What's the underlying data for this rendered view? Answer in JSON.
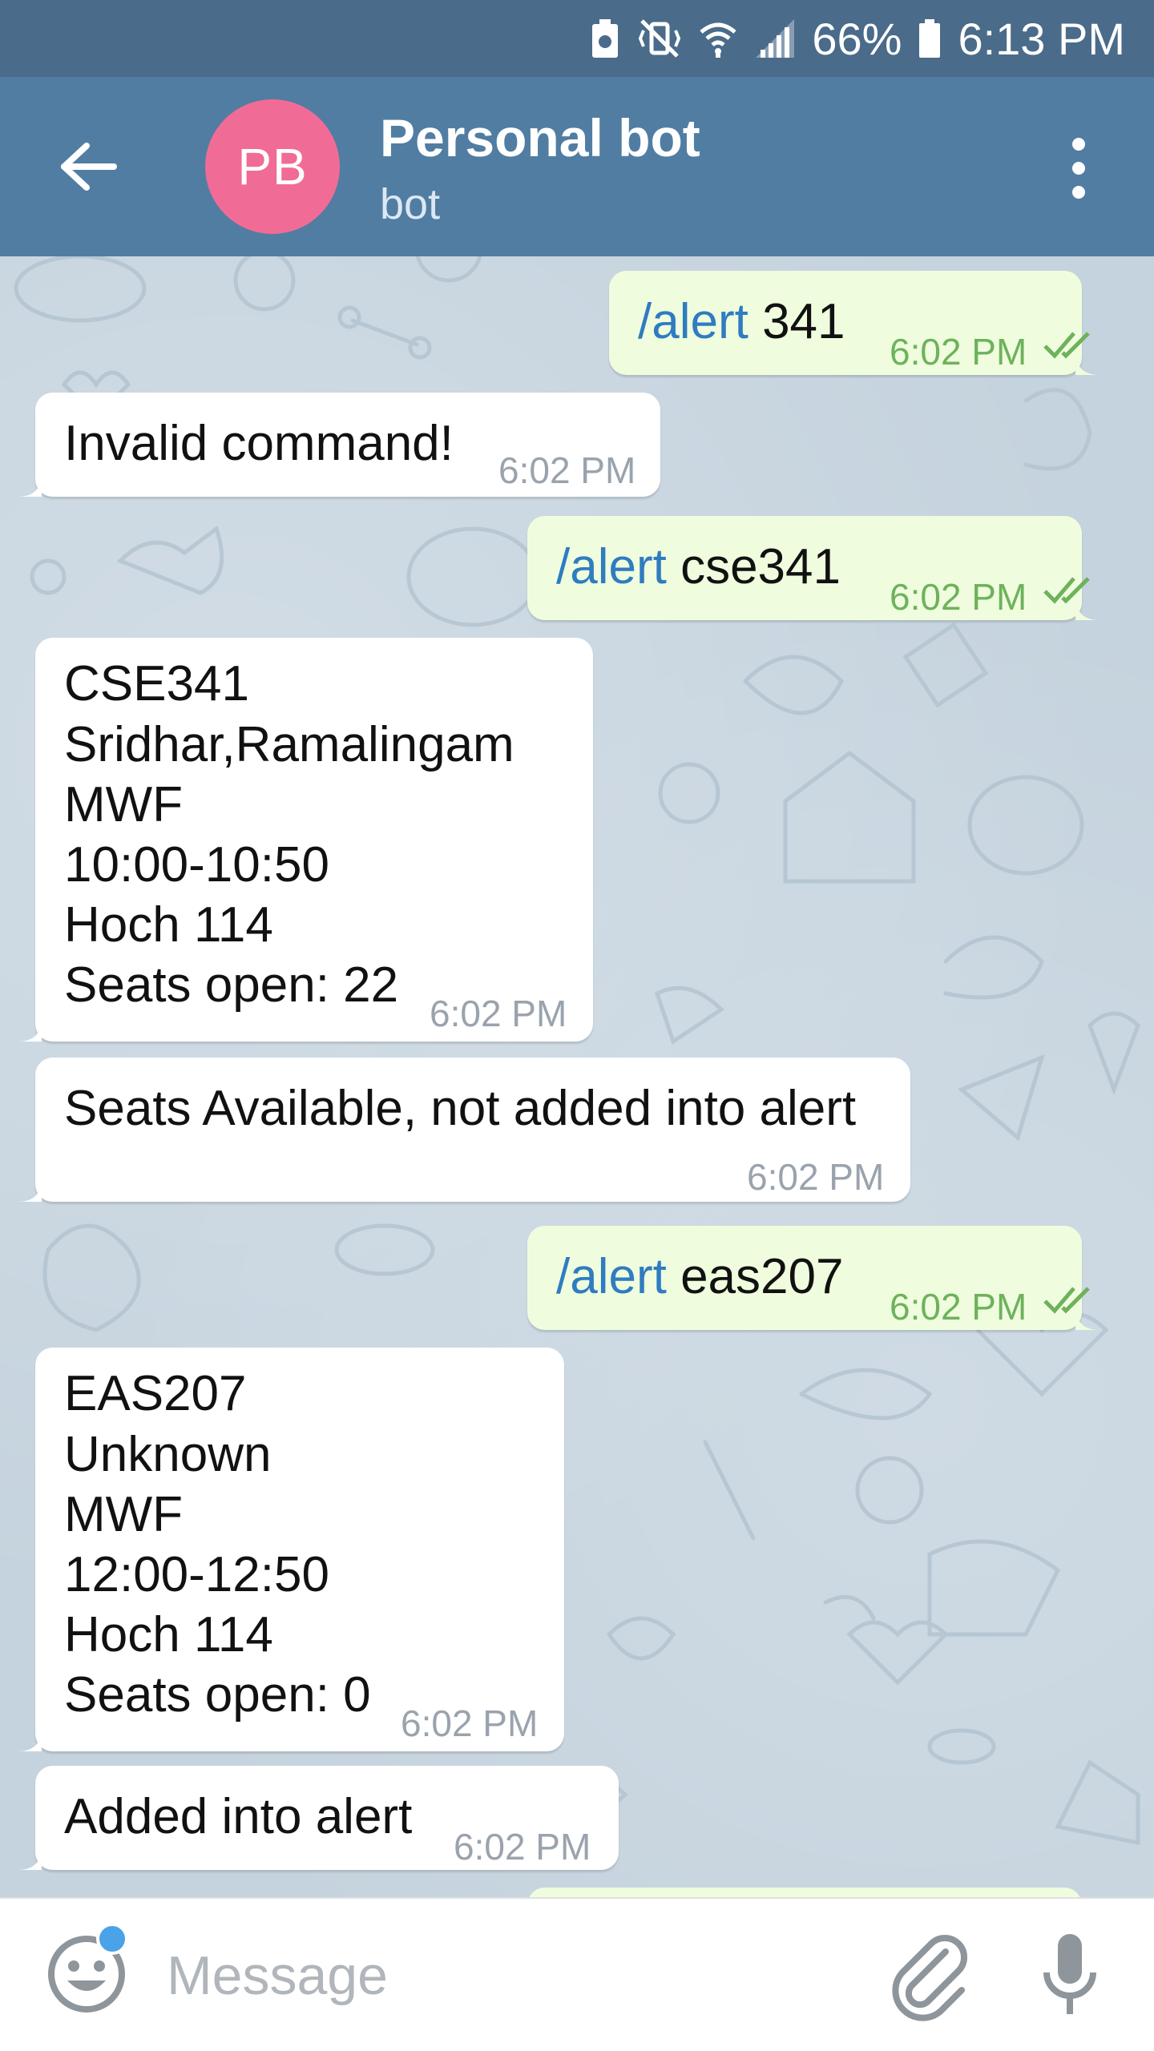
{
  "status_bar": {
    "battery_percent": "66%",
    "time": "6:13 PM",
    "icons": [
      "battery-saver-icon",
      "vibrate-mute-icon",
      "wifi-icon",
      "signal-icon",
      "battery-icon"
    ]
  },
  "header": {
    "avatar_initials": "PB",
    "avatar_color": "#f06c96",
    "title": "Personal bot",
    "subtitle": "bot"
  },
  "messages": [
    {
      "dir": "out",
      "command": "/alert",
      "arg": " 341",
      "time": "6:02 PM"
    },
    {
      "dir": "in",
      "lines": [
        "Invalid command!"
      ],
      "time": "6:02 PM"
    },
    {
      "dir": "out",
      "command": "/alert",
      "arg": " cse341",
      "time": "6:02 PM"
    },
    {
      "dir": "in",
      "lines": [
        "CSE341",
        "Sridhar,Ramalingam",
        "MWF",
        "10:00-10:50",
        "Hoch 114",
        "Seats open: 22"
      ],
      "time": "6:02 PM"
    },
    {
      "dir": "in",
      "lines": [
        "Seats Available, not added into alert"
      ],
      "time": "6:02 PM"
    },
    {
      "dir": "out",
      "command": "/alert",
      "arg": " eas207",
      "time": "6:02 PM"
    },
    {
      "dir": "in",
      "lines": [
        "EAS207",
        "Unknown",
        "MWF",
        "12:00-12:50",
        "Hoch 114",
        "Seats open: 0"
      ],
      "time": "6:02 PM"
    },
    {
      "dir": "in",
      "lines": [
        "Added into alert"
      ],
      "time": "6:02 PM"
    }
  ],
  "input": {
    "placeholder": "Message"
  },
  "colors": {
    "header_bg": "#517da2",
    "status_bg": "#4a6b8a",
    "outgoing_bubble": "#effdde",
    "incoming_bubble": "#ffffff",
    "command_link": "#2f7cc0",
    "outgoing_time": "#6eb25c"
  }
}
